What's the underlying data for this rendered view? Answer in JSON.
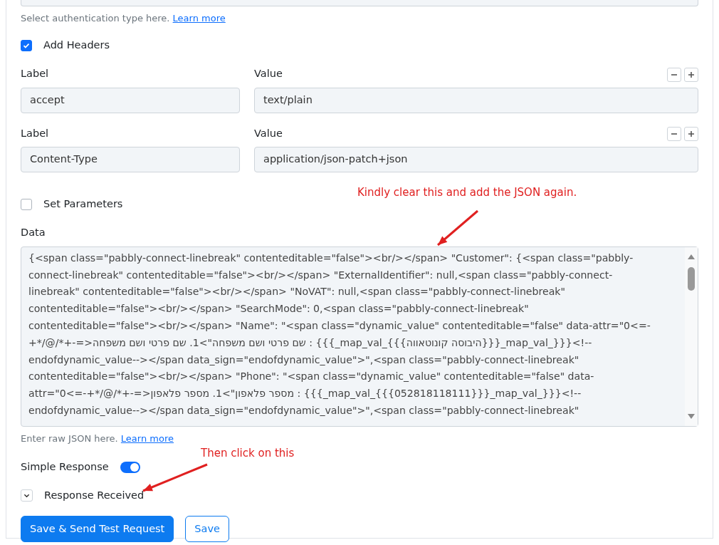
{
  "auth_help": {
    "text": "Select authentication type here.",
    "link": "Learn more"
  },
  "add_headers": {
    "label": "Add Headers",
    "checked": true
  },
  "headers": [
    {
      "label_heading": "Label",
      "value_heading": "Value",
      "label": "accept",
      "value": "text/plain"
    },
    {
      "label_heading": "Label",
      "value_heading": "Value",
      "label": "Content-Type",
      "value": "application/json-patch+json"
    }
  ],
  "set_parameters": {
    "label": "Set Parameters",
    "checked": false
  },
  "data": {
    "heading": "Data",
    "lines": [
      "{<span class=\"pabbly-connect-linebreak\" contenteditable=\"false\"><br/></span> \"Customer\": {<span class=\"pabbly-",
      "connect-linebreak\" contenteditable=\"false\"><br/></span> \"ExternalIdentifier\": null,<span class=\"pabbly-connect-",
      "linebreak\" contenteditable=\"false\"><br/></span> \"NoVAT\": null,<span class=\"pabbly-connect-linebreak\"",
      "contenteditable=\"false\"><br/></span> \"SearchMode\": 0,<span class=\"pabbly-connect-linebreak\"",
      "contenteditable=\"false\"><br/></span> \"Name\": \"<span class=\"dynamic_value\" contenteditable=\"false\" data-attr=\"0<=-",
      "+*/@/*+-=>שם פרטי ושם משפחה\">1. שם פרטי ושם משפחה : {{{_map_val_{{{היבוסה קונוטאווה}}}_map_val_}}}<!--",
      "endofdynamic_value--></span data_sign=\"endofdynamic_value\">\",<span class=\"pabbly-connect-linebreak\"",
      "contenteditable=\"false\"><br/></span> \"Phone\": \"<span class=\"dynamic_value\" contenteditable=\"false\" data-",
      "attr=\"0<=-+*/@/*+-=>מספר פלאפון\">1. מספר פלאפון : {{{_map_val_{{{052818118111}}}_map_val_}}}<!--",
      "endofdynamic_value--></span data_sign=\"endofdynamic_value\">\",<span class=\"pabbly-connect-linebreak\""
    ],
    "help": "Enter raw JSON here.",
    "help_link": "Learn more"
  },
  "simple_response": {
    "label": "Simple Response",
    "on": true
  },
  "response_received": {
    "label": "Response Received"
  },
  "buttons": [
    {
      "label": "Save & Send Test Request",
      "kind": "primary"
    },
    {
      "label": "Save",
      "kind": "outline"
    }
  ],
  "annotations": [
    {
      "text": "Kindly clear this and add the JSON again."
    },
    {
      "text": "Then click on this"
    }
  ]
}
